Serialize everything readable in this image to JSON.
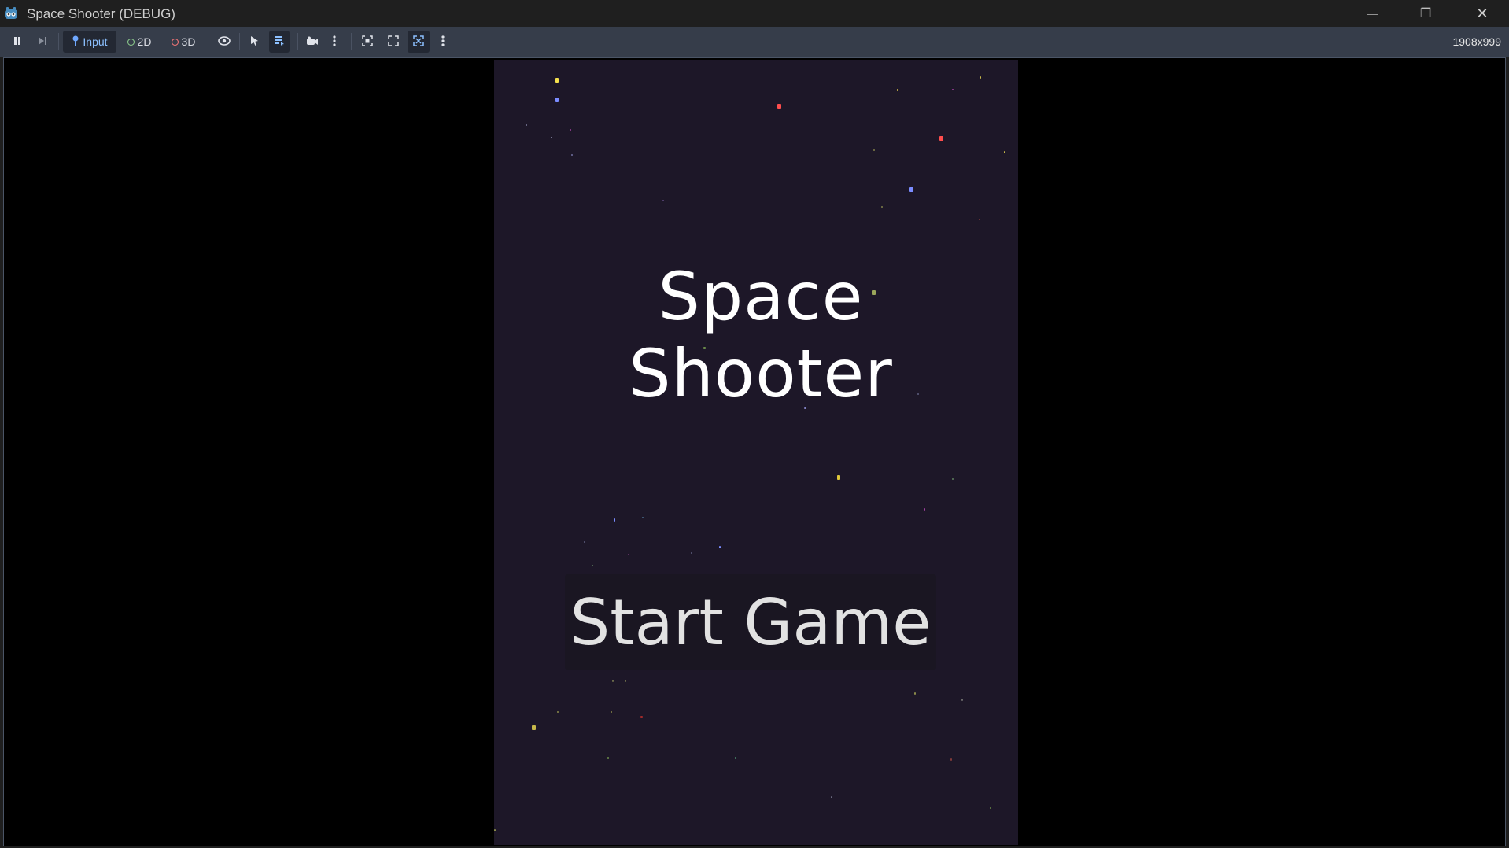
{
  "window": {
    "title": "Space Shooter (DEBUG)",
    "min_glyph": "—",
    "max_glyph": "❐",
    "close_glyph": "✕"
  },
  "toolbar": {
    "input_label": "Input",
    "mode_2d_label": "2D",
    "mode_3d_label": "3D",
    "resolution": "1908x999"
  },
  "game": {
    "title": "Space Shooter",
    "start_label": "Start Game"
  },
  "colors": {
    "game_bg": "#1d1728",
    "toolbar_bg": "#363d4a",
    "accent": "#6fa8ff"
  }
}
